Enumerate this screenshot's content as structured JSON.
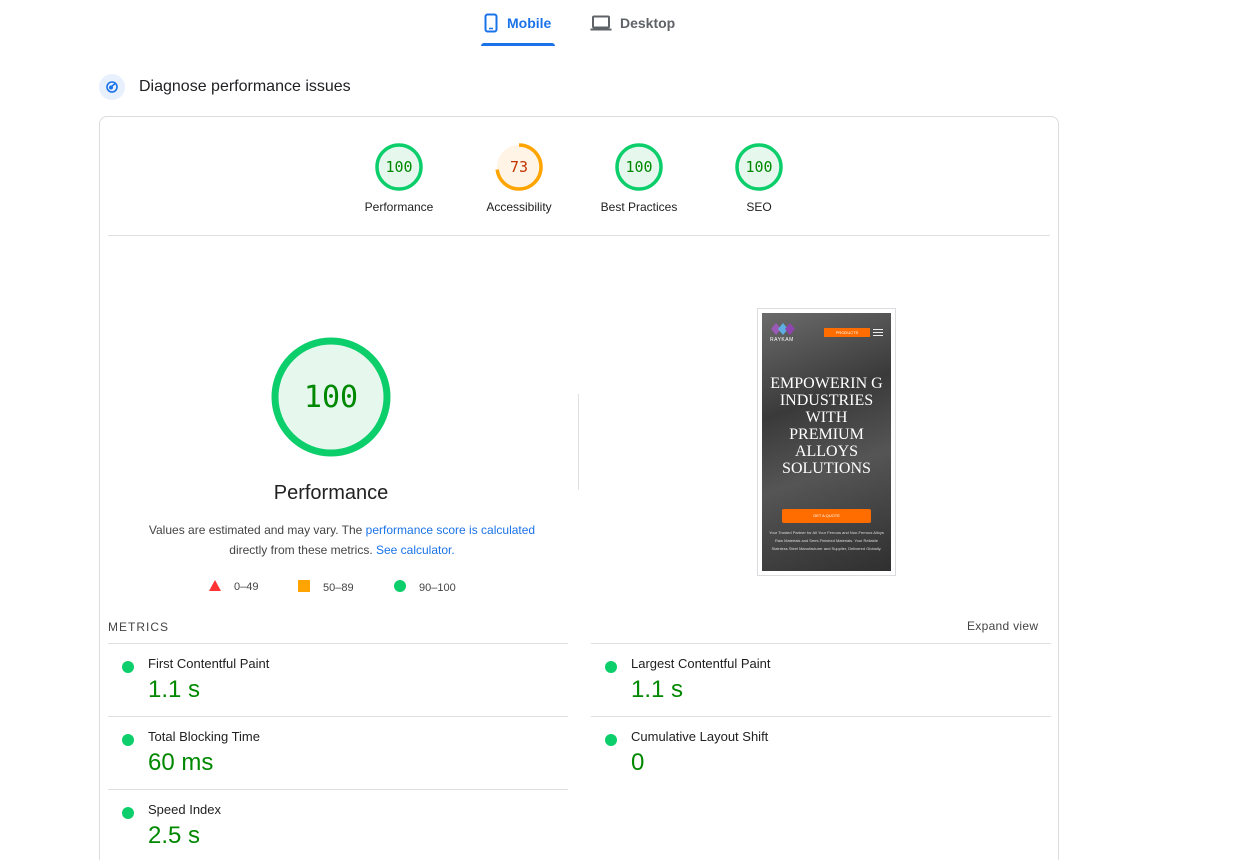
{
  "tabs": [
    {
      "label": "Mobile",
      "icon": "smartphone-icon",
      "active": true
    },
    {
      "label": "Desktop",
      "icon": "laptop-icon",
      "active": false
    }
  ],
  "section": {
    "title": "Diagnose performance issues",
    "icon": "diagnose-icon"
  },
  "categories": [
    {
      "label": "Performance",
      "score": "100",
      "score_value": 100,
      "color": "#0cce6b"
    },
    {
      "label": "Accessibility",
      "score": "73",
      "score_value": 73,
      "color": "#ffa400"
    },
    {
      "label": "Best Practices",
      "score": "100",
      "score_value": 100,
      "color": "#0cce6b"
    },
    {
      "label": "SEO",
      "score": "100",
      "score_value": 100,
      "color": "#0cce6b"
    }
  ],
  "performance": {
    "score": "100",
    "title": "Performance",
    "note_prefix": "Values are estimated and may vary. The ",
    "note_link1": "performance score is calculated",
    "note_middle": " directly from these metrics. ",
    "note_link2": "See calculator."
  },
  "legend": [
    {
      "range": "0–49",
      "shape": "triangle",
      "color": "#ff3333"
    },
    {
      "range": "50–89",
      "shape": "square",
      "color": "#ffa400"
    },
    {
      "range": "90–100",
      "shape": "circle",
      "color": "#0cce6b"
    }
  ],
  "screenshot": {
    "brand": "RAYKAM",
    "menu_button": "PRODUCTS",
    "headline": "EMPOWERIN G INDUSTRIES WITH PREMIUM ALLOYS SOLUTIONS",
    "cta": "GET A QUOTE",
    "subtext": "Your Trusted Partner for All Your Ferrous and Non-Ferrous Alloys Raw Materials and Semi-Finished Materials. Your Reliable Stainless Steel Manufacturer and Supplier, Delivered Globally."
  },
  "metrics": {
    "label": "METRICS",
    "expand_label": "Expand view",
    "items": [
      {
        "name": "First Contentful Paint",
        "value": "1.1 s"
      },
      {
        "name": "Largest Contentful Paint",
        "value": "1.1 s"
      },
      {
        "name": "Total Blocking Time",
        "value": "60 ms"
      },
      {
        "name": "Cumulative Layout Shift",
        "value": "0"
      },
      {
        "name": "Speed Index",
        "value": "2.5 s"
      }
    ]
  },
  "colors": {
    "accent": "#1a73e8",
    "pass": "#0cce6b",
    "average": "#ffa400",
    "fail": "#ff3333",
    "pass_text": "#008800"
  }
}
